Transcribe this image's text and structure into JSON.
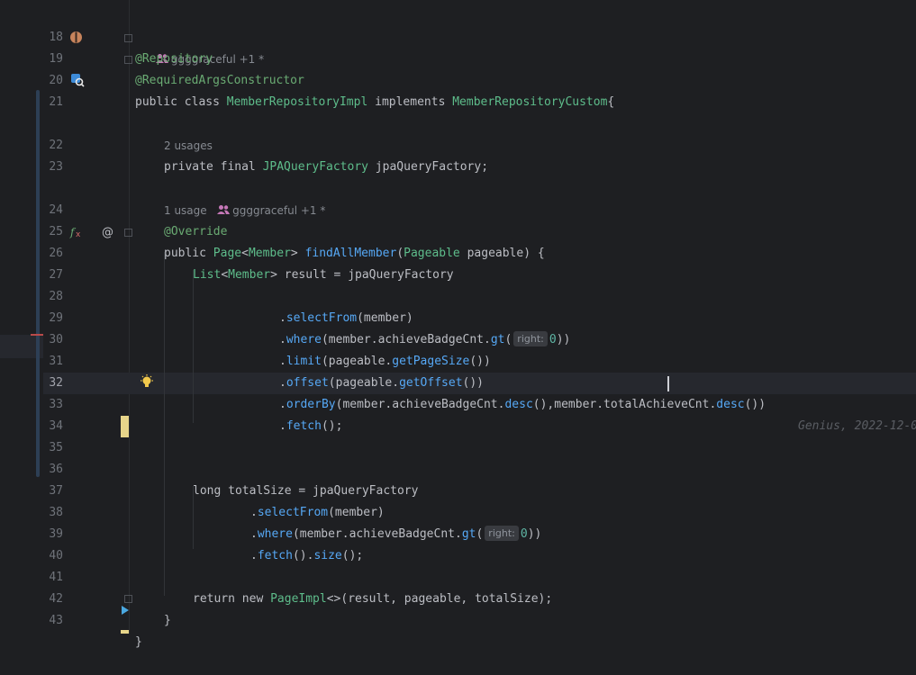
{
  "editor": {
    "author_hint_top": "ggggraceful +1 *",
    "usages_22": "2 usages",
    "usages_24": "1 usage",
    "author_hint_24": "ggggraceful +1 *",
    "blame_32": "Genius, 2022-12-0",
    "hint_right_29": "right:",
    "hint_right_38": "right:"
  },
  "lines": {
    "l18": "18",
    "l19": "19",
    "l20": "20",
    "l21": "21",
    "l22": "22",
    "l23": "23",
    "l24": "24",
    "l25": "25",
    "l26": "26",
    "l27": "27",
    "l28": "28",
    "l29": "29",
    "l30": "30",
    "l31": "31",
    "l32": "32",
    "l33": "33",
    "l34": "34",
    "l35": "35",
    "l36": "36",
    "l37": "37",
    "l38": "38",
    "l39": "39",
    "l40": "40",
    "l41": "41",
    "l42": "42",
    "l43": "43"
  },
  "code": {
    "c18": "@Repository",
    "c19": "@RequiredArgsConstructor",
    "c20_a": "public class ",
    "c20_b": "MemberRepositoryImpl",
    "c20_c": " implements ",
    "c20_d": "MemberRepositoryCustom",
    "c20_e": "{",
    "c22_a": "private final ",
    "c22_b": "JPAQueryFactory",
    "c22_c": " jpaQueryFactory;",
    "c24": "@Override",
    "c25_a": "public ",
    "c25_b": "Page",
    "c25_c": "<",
    "c25_d": "Member",
    "c25_e": "> ",
    "c25_f": "findAllMember",
    "c25_g": "(",
    "c25_h": "Pageable",
    "c25_i": " pageable) {",
    "c26_a": "List",
    "c26_b": "<",
    "c26_c": "Member",
    "c26_d": "> result = jpaQueryFactory",
    "c28_a": ".",
    "c28_b": "selectFrom",
    "c28_c": "(member)",
    "c29_a": ".",
    "c29_b": "where",
    "c29_c": "(member.achieveBadgeCnt.",
    "c29_d": "gt",
    "c29_e": "(",
    "c29_f": "0",
    "c29_g": "))",
    "c30_a": ".",
    "c30_b": "limit",
    "c30_c": "(pageable.",
    "c30_d": "getPageSize",
    "c30_e": "())",
    "c31_a": ".",
    "c31_b": "offset",
    "c31_c": "(pageable.",
    "c31_d": "getOffset",
    "c31_e": "())",
    "c32_a": ".",
    "c32_b": "orderBy",
    "c32_c": "(member.achieveBadgeCnt.",
    "c32_d": "desc",
    "c32_e": "(),member.totalAch",
    "c32_f": "ieveCnt.",
    "c32_g": "desc",
    "c32_h": "())",
    "c33_a": ".",
    "c33_b": "fetch",
    "c33_c": "();",
    "c36_a": "long",
    "c36_b": " totalSize = jpaQueryFactory",
    "c37_a": ".",
    "c37_b": "selectFrom",
    "c37_c": "(member)",
    "c38_a": ".",
    "c38_b": "where",
    "c38_c": "(member.achieveBadgeCnt.",
    "c38_d": "gt",
    "c38_e": "(",
    "c38_f": "0",
    "c38_g": "))",
    "c39_a": ".",
    "c39_b": "fetch",
    "c39_c": "().",
    "c39_d": "size",
    "c39_e": "();",
    "c41_a": "return new ",
    "c41_b": "PageImpl",
    "c41_c": "<>(result, pageable, totalSize);",
    "c42": "}",
    "c43": "}"
  },
  "icons": {
    "bean": "spring-bean-icon",
    "inspect": "bean-inspect-icon",
    "fx": "implementation-fx-icon",
    "at": "annotation-at-icon",
    "bulb": "lightbulb-icon",
    "run": "run-arrow-icon"
  },
  "colors": {
    "background": "#1e1f22",
    "keyword": "#cf8e6d",
    "method": "#56a8f5",
    "annotation": "#b3ae60",
    "class": "#5ebd8b",
    "change_marker": "#e7d58a"
  }
}
